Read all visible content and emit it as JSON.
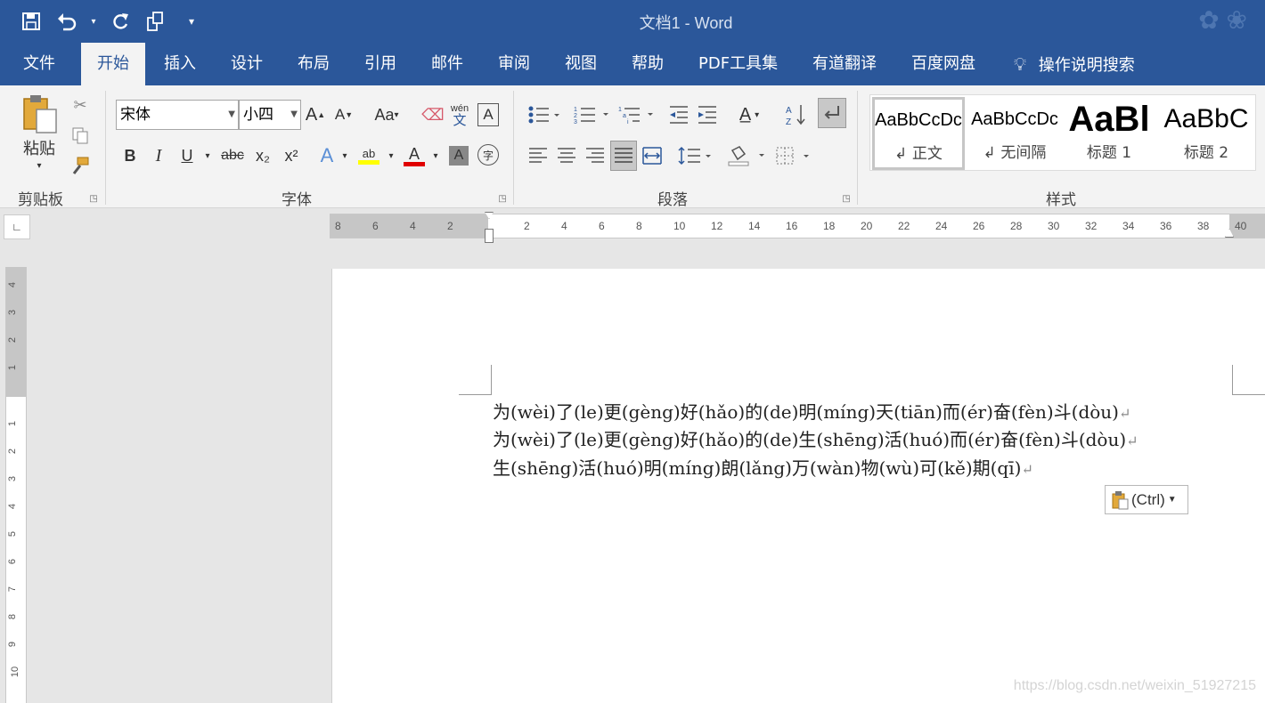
{
  "titlebar": {
    "title": "文档1  -  Word",
    "qat": {
      "save": "save-icon",
      "undo": "undo-icon",
      "redo": "redo-icon",
      "touch": "touch-mode-icon",
      "customize": "customize-icon"
    }
  },
  "menu": {
    "tabs": [
      "文件",
      "开始",
      "插入",
      "设计",
      "布局",
      "引用",
      "邮件",
      "审阅",
      "视图",
      "帮助",
      "PDF工具集",
      "有道翻译",
      "百度网盘"
    ],
    "active": "开始",
    "tell_me": "操作说明搜索"
  },
  "ribbon": {
    "clipboard": {
      "label": "剪贴板",
      "paste": "粘贴"
    },
    "font": {
      "label": "字体",
      "font_name": "宋体",
      "font_size": "小四",
      "grow": "A",
      "shrink": "A",
      "case": "Aa",
      "phonetic_top": "wén",
      "phonetic_bottom": "文",
      "bold": "B",
      "italic": "I",
      "underline": "U",
      "strike": "abc",
      "sub": "x₂",
      "sup": "x²",
      "enclose": "字"
    },
    "paragraph": {
      "label": "段落"
    },
    "styles": {
      "label": "样式",
      "items": [
        {
          "preview": "AaBbCcDc",
          "name": "↲ 正文"
        },
        {
          "preview": "AaBbCcDc",
          "name": "↲ 无间隔"
        },
        {
          "preview": "AaBl",
          "name": "标题 1"
        },
        {
          "preview": "AaBbC",
          "name": "标题 2"
        }
      ]
    }
  },
  "ruler": {
    "h_left_ticks": [
      "8",
      "6",
      "4",
      "2"
    ],
    "h_right_ticks": [
      "2",
      "4",
      "6",
      "8",
      "10",
      "12",
      "14",
      "16",
      "18",
      "20",
      "22",
      "24",
      "26",
      "28",
      "30",
      "32",
      "34",
      "36",
      "38",
      "40"
    ],
    "v_top_ticks": [
      "4",
      "3",
      "2",
      "1"
    ],
    "v_bottom_ticks": [
      "1",
      "2",
      "3",
      "4",
      "5",
      "6",
      "7",
      "8",
      "9",
      "10"
    ]
  },
  "document": {
    "lines": [
      "为(wèi)了(le)更(gèng)好(hǎo)的(de)明(míng)天(tiān)而(ér)奋(fèn)斗(dòu)",
      "为(wèi)了(le)更(gèng)好(hǎo)的(de)生(shēng)活(huó)而(ér)奋(fèn)斗(dòu)",
      "生(shēng)活(huó)明(míng)朗(lǎng)万(wàn)物(wù)可(kě)期(qī)"
    ],
    "paragraph_mark": "↵",
    "paste_options": "(Ctrl)"
  },
  "watermark": "https://blog.csdn.net/weixin_51927215"
}
